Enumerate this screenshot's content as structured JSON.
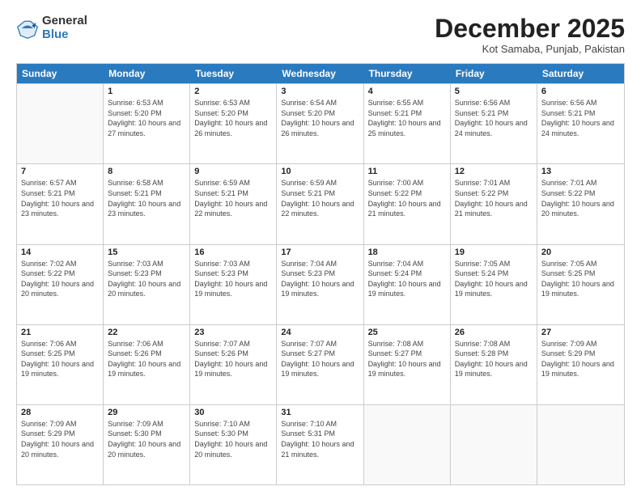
{
  "logo": {
    "general": "General",
    "blue": "Blue"
  },
  "header": {
    "month": "December 2025",
    "location": "Kot Samaba, Punjab, Pakistan"
  },
  "weekdays": [
    "Sunday",
    "Monday",
    "Tuesday",
    "Wednesday",
    "Thursday",
    "Friday",
    "Saturday"
  ],
  "weeks": [
    [
      {
        "day": "",
        "empty": true
      },
      {
        "day": "1",
        "sunrise": "6:53 AM",
        "sunset": "5:20 PM",
        "daylight": "10 hours and 27 minutes."
      },
      {
        "day": "2",
        "sunrise": "6:53 AM",
        "sunset": "5:20 PM",
        "daylight": "10 hours and 26 minutes."
      },
      {
        "day": "3",
        "sunrise": "6:54 AM",
        "sunset": "5:20 PM",
        "daylight": "10 hours and 26 minutes."
      },
      {
        "day": "4",
        "sunrise": "6:55 AM",
        "sunset": "5:21 PM",
        "daylight": "10 hours and 25 minutes."
      },
      {
        "day": "5",
        "sunrise": "6:56 AM",
        "sunset": "5:21 PM",
        "daylight": "10 hours and 24 minutes."
      },
      {
        "day": "6",
        "sunrise": "6:56 AM",
        "sunset": "5:21 PM",
        "daylight": "10 hours and 24 minutes."
      }
    ],
    [
      {
        "day": "7",
        "sunrise": "6:57 AM",
        "sunset": "5:21 PM",
        "daylight": "10 hours and 23 minutes."
      },
      {
        "day": "8",
        "sunrise": "6:58 AM",
        "sunset": "5:21 PM",
        "daylight": "10 hours and 23 minutes."
      },
      {
        "day": "9",
        "sunrise": "6:59 AM",
        "sunset": "5:21 PM",
        "daylight": "10 hours and 22 minutes."
      },
      {
        "day": "10",
        "sunrise": "6:59 AM",
        "sunset": "5:21 PM",
        "daylight": "10 hours and 22 minutes."
      },
      {
        "day": "11",
        "sunrise": "7:00 AM",
        "sunset": "5:22 PM",
        "daylight": "10 hours and 21 minutes."
      },
      {
        "day": "12",
        "sunrise": "7:01 AM",
        "sunset": "5:22 PM",
        "daylight": "10 hours and 21 minutes."
      },
      {
        "day": "13",
        "sunrise": "7:01 AM",
        "sunset": "5:22 PM",
        "daylight": "10 hours and 20 minutes."
      }
    ],
    [
      {
        "day": "14",
        "sunrise": "7:02 AM",
        "sunset": "5:22 PM",
        "daylight": "10 hours and 20 minutes."
      },
      {
        "day": "15",
        "sunrise": "7:03 AM",
        "sunset": "5:23 PM",
        "daylight": "10 hours and 20 minutes."
      },
      {
        "day": "16",
        "sunrise": "7:03 AM",
        "sunset": "5:23 PM",
        "daylight": "10 hours and 19 minutes."
      },
      {
        "day": "17",
        "sunrise": "7:04 AM",
        "sunset": "5:23 PM",
        "daylight": "10 hours and 19 minutes."
      },
      {
        "day": "18",
        "sunrise": "7:04 AM",
        "sunset": "5:24 PM",
        "daylight": "10 hours and 19 minutes."
      },
      {
        "day": "19",
        "sunrise": "7:05 AM",
        "sunset": "5:24 PM",
        "daylight": "10 hours and 19 minutes."
      },
      {
        "day": "20",
        "sunrise": "7:05 AM",
        "sunset": "5:25 PM",
        "daylight": "10 hours and 19 minutes."
      }
    ],
    [
      {
        "day": "21",
        "sunrise": "7:06 AM",
        "sunset": "5:25 PM",
        "daylight": "10 hours and 19 minutes."
      },
      {
        "day": "22",
        "sunrise": "7:06 AM",
        "sunset": "5:26 PM",
        "daylight": "10 hours and 19 minutes."
      },
      {
        "day": "23",
        "sunrise": "7:07 AM",
        "sunset": "5:26 PM",
        "daylight": "10 hours and 19 minutes."
      },
      {
        "day": "24",
        "sunrise": "7:07 AM",
        "sunset": "5:27 PM",
        "daylight": "10 hours and 19 minutes."
      },
      {
        "day": "25",
        "sunrise": "7:08 AM",
        "sunset": "5:27 PM",
        "daylight": "10 hours and 19 minutes."
      },
      {
        "day": "26",
        "sunrise": "7:08 AM",
        "sunset": "5:28 PM",
        "daylight": "10 hours and 19 minutes."
      },
      {
        "day": "27",
        "sunrise": "7:09 AM",
        "sunset": "5:29 PM",
        "daylight": "10 hours and 19 minutes."
      }
    ],
    [
      {
        "day": "28",
        "sunrise": "7:09 AM",
        "sunset": "5:29 PM",
        "daylight": "10 hours and 20 minutes."
      },
      {
        "day": "29",
        "sunrise": "7:09 AM",
        "sunset": "5:30 PM",
        "daylight": "10 hours and 20 minutes."
      },
      {
        "day": "30",
        "sunrise": "7:10 AM",
        "sunset": "5:30 PM",
        "daylight": "10 hours and 20 minutes."
      },
      {
        "day": "31",
        "sunrise": "7:10 AM",
        "sunset": "5:31 PM",
        "daylight": "10 hours and 21 minutes."
      },
      {
        "day": "",
        "empty": true
      },
      {
        "day": "",
        "empty": true
      },
      {
        "day": "",
        "empty": true
      }
    ]
  ]
}
